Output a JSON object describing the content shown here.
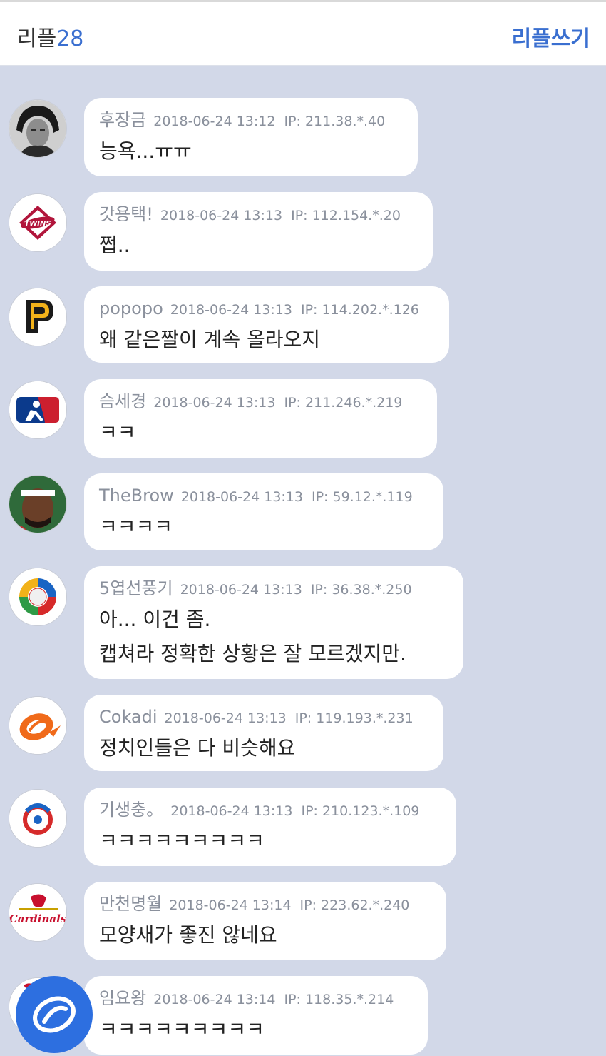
{
  "header": {
    "label": "리플",
    "count": "28",
    "write_button": "리플쓰기"
  },
  "comments": [
    {
      "nick": "후장금",
      "date": "2018-06-24 13:12",
      "ip": "IP: 211.38.*.40",
      "lines": [
        "능욕...ㅠㅠ"
      ],
      "avatar_icon": "portrait-avatar-icon"
    },
    {
      "nick": "갓용택!",
      "date": "2018-06-24 13:13",
      "ip": "IP: 112.154.*.20",
      "lines": [
        "쩝.."
      ],
      "avatar_icon": "lg-twins-logo-icon"
    },
    {
      "nick": "popopo",
      "date": "2018-06-24 13:13",
      "ip": "IP: 114.202.*.126",
      "lines": [
        "왜 같은짤이 계속 올라오지"
      ],
      "avatar_icon": "pirates-logo-icon"
    },
    {
      "nick": "슴세경",
      "date": "2018-06-24 13:13",
      "ip": "IP: 211.246.*.219",
      "lines": [
        "ㅋㅋ"
      ],
      "avatar_icon": "mlb-logo-icon"
    },
    {
      "nick": "TheBrow",
      "date": "2018-06-24 13:13",
      "ip": "IP: 59.12.*.119",
      "lines": [
        "ㅋㅋㅋㅋ"
      ],
      "avatar_icon": "player-avatar-icon"
    },
    {
      "nick": "5엽선풍기",
      "date": "2018-06-24 13:13",
      "ip": "IP: 36.38.*.250",
      "lines": [
        "아... 이건 좀.",
        "캡쳐라 정확한 상황은 잘 모르겠지만."
      ],
      "avatar_icon": "wbc-logo-icon"
    },
    {
      "nick": "Cokadi",
      "date": "2018-06-24 13:13",
      "ip": "IP: 119.193.*.231",
      "lines": [
        "정치인들은 다 비슷해요"
      ],
      "avatar_icon": "orange-swoosh-logo-icon"
    },
    {
      "nick": "기생충。",
      "date": "2018-06-24 13:13",
      "ip": "IP: 210.123.*.109",
      "lines": [
        "ㅋㅋㅋㅋㅋㅋㅋㅋㅋ"
      ],
      "avatar_icon": "kbo-logo-icon"
    },
    {
      "nick": "만천명월",
      "date": "2018-06-24 13:14",
      "ip": "IP: 223.62.*.240",
      "lines": [
        "모양새가 좋진 않네요"
      ],
      "avatar_icon": "cardinals-logo-icon"
    },
    {
      "nick": "임요왕",
      "date": "2018-06-24 13:14",
      "ip": "IP: 118.35.*.214",
      "lines": [
        "ㅋㅋㅋㅋㅋㅋㅋㅋㅋ"
      ],
      "avatar_icon": "partial-avatar-icon"
    }
  ],
  "fab_icon": "write-fab-icon",
  "colors": {
    "accent": "#3a6fd0",
    "background": "#d2d8e8",
    "bubble": "#ffffff",
    "meta": "#8a909c",
    "fab": "#2d6fe0"
  }
}
